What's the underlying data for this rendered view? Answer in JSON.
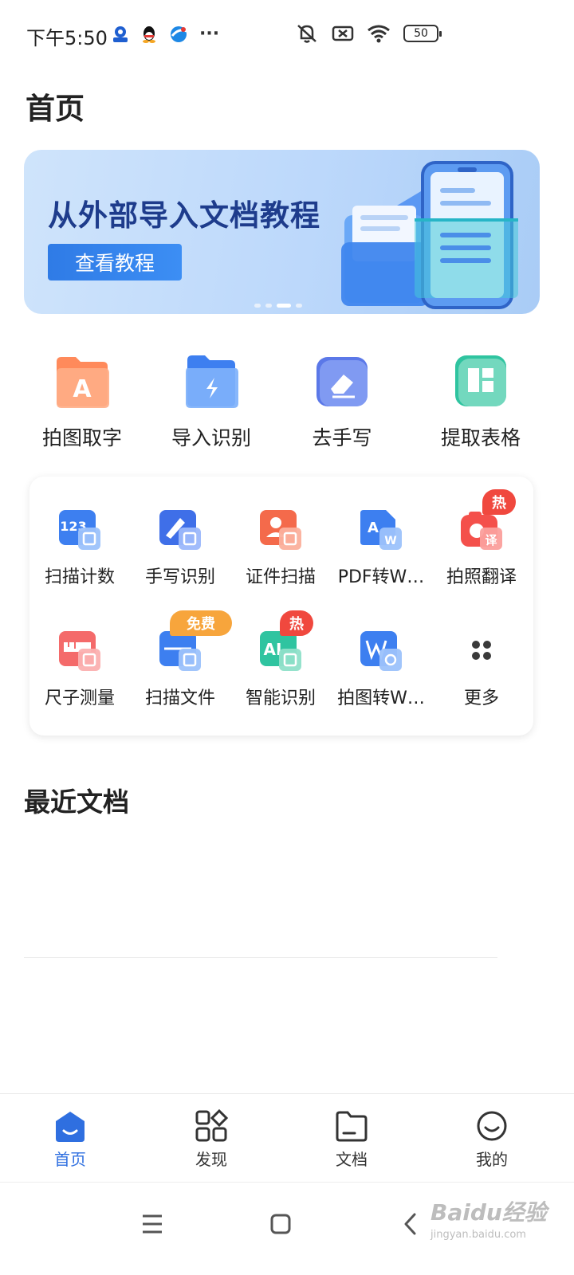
{
  "status_bar": {
    "time": "下午5:50",
    "more": "···",
    "battery": "50"
  },
  "page_title": "首页",
  "banner": {
    "title": "从外部导入文档教程",
    "button": "查看教程",
    "carousel_index": 3,
    "carousel_total": 4
  },
  "main_tools": [
    {
      "label": "拍图取字",
      "icon": "photo-text-icon"
    },
    {
      "label": "导入识别",
      "icon": "import-folder-icon"
    },
    {
      "label": "去手写",
      "icon": "eraser-icon"
    },
    {
      "label": "提取表格",
      "icon": "table-icon"
    }
  ],
  "more_tools": [
    {
      "label": "扫描计数",
      "icon": "scan-count-icon"
    },
    {
      "label": "手写识别",
      "icon": "handwriting-icon"
    },
    {
      "label": "证件扫描",
      "icon": "id-scan-icon"
    },
    {
      "label": "PDF转W…",
      "icon": "pdf-to-word-icon"
    },
    {
      "label": "拍照翻译",
      "icon": "photo-translate-icon",
      "badge": "热"
    },
    {
      "label": "尺子测量",
      "icon": "ruler-icon"
    },
    {
      "label": "扫描文件",
      "icon": "scan-file-icon",
      "badge": "免费"
    },
    {
      "label": "智能识别",
      "icon": "smart-recognize-icon",
      "badge": "热"
    },
    {
      "label": "拍图转W…",
      "icon": "photo-to-word-icon"
    },
    {
      "label": "更多",
      "icon": "more-grid-icon"
    }
  ],
  "badges": {
    "hot": "热",
    "free": "免费",
    "translate_glyph": "译",
    "id_glyph": "A"
  },
  "recent_docs_title": "最近文档",
  "tab_bar": [
    {
      "label": "首页",
      "icon": "home-icon",
      "active": true
    },
    {
      "label": "发现",
      "icon": "discover-icon",
      "active": false
    },
    {
      "label": "文档",
      "icon": "folder-icon",
      "active": false
    },
    {
      "label": "我的",
      "icon": "smile-icon",
      "active": false
    }
  ],
  "watermark": {
    "brand": "Baidu经验",
    "url": "jingyan.baidu.com"
  },
  "colors": {
    "accent": "#2f6fe0",
    "hot_badge": "#f0483e",
    "free_badge": "#f7a53c"
  }
}
